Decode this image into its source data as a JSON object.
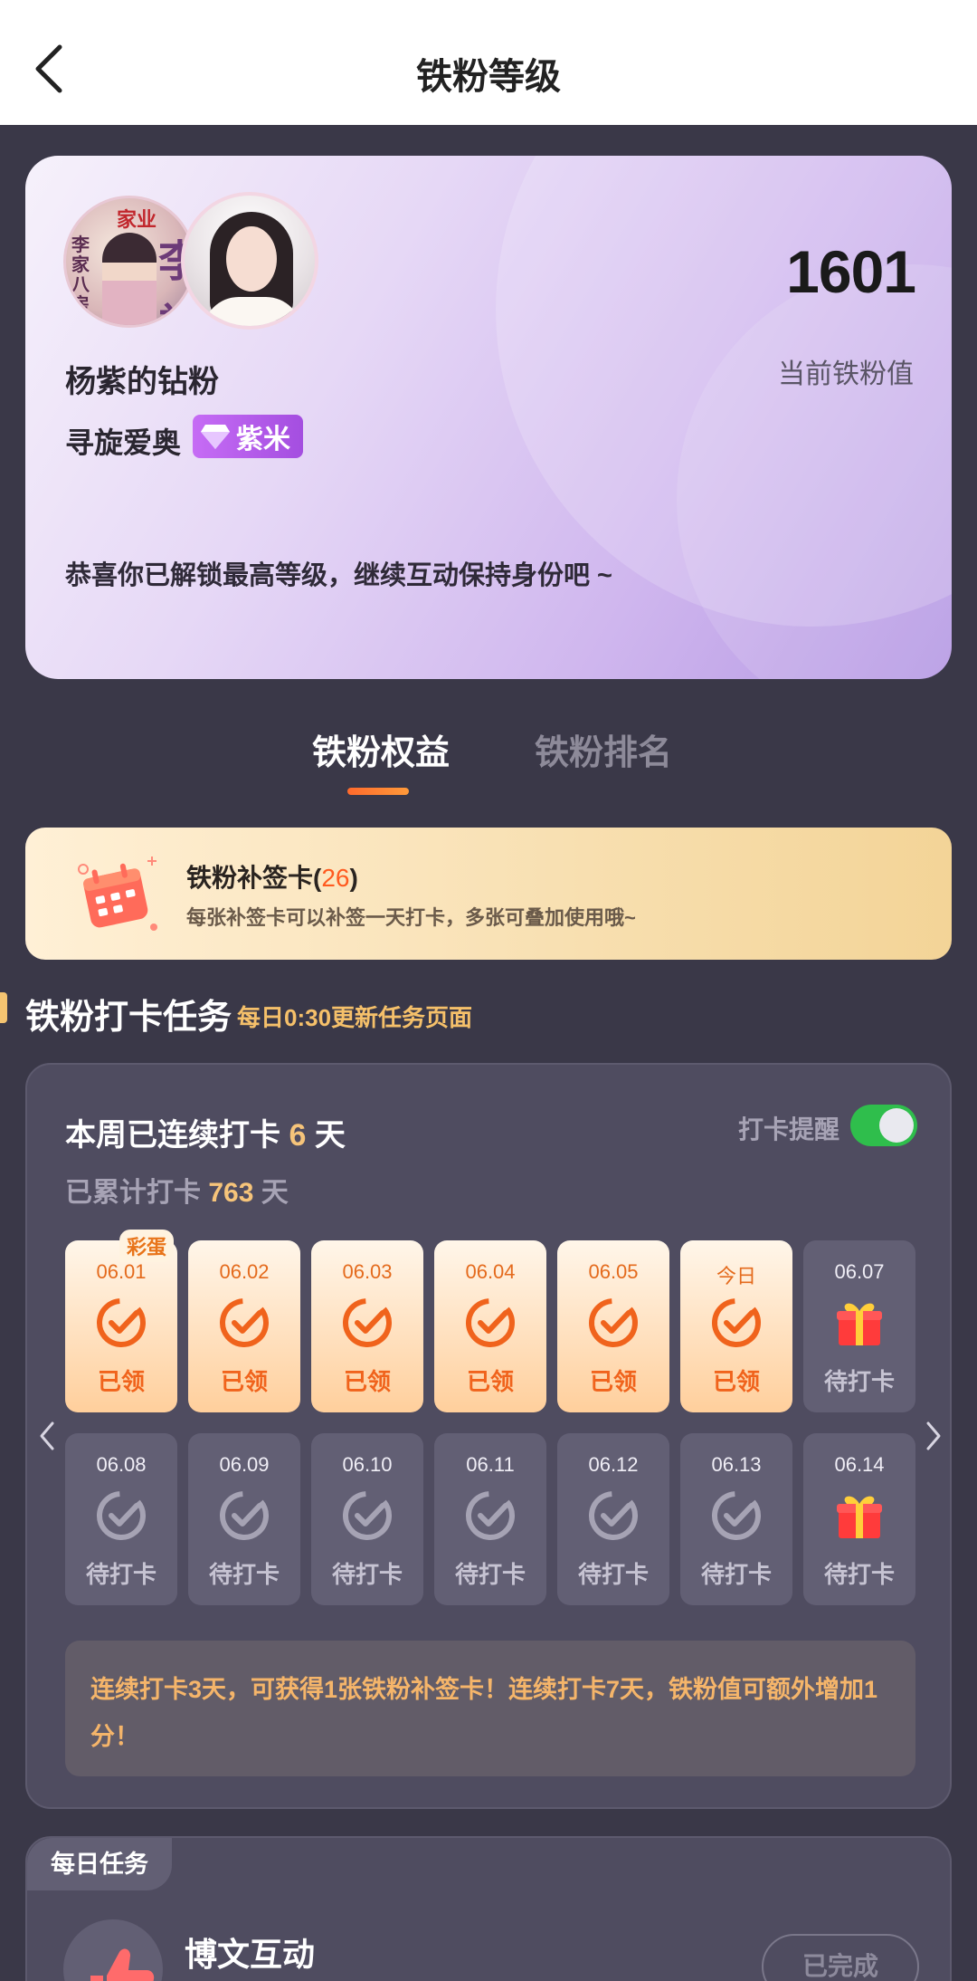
{
  "header": {
    "title": "铁粉等级"
  },
  "profile": {
    "avatar_text_top": "家业",
    "avatar_text_side": "李家八房",
    "avatar_text_big": "李衫",
    "score": "1601",
    "score_label": "当前铁粉值",
    "fan_title": "杨紫的钻粉",
    "fan_name": "寻旋爱奥",
    "badge_label": "紫米",
    "congrats": "恭喜你已解锁最高等级，继续互动保持身份吧 ~"
  },
  "tabs": [
    {
      "label": "铁粉权益",
      "active": true
    },
    {
      "label": "铁粉排名",
      "active": false
    }
  ],
  "makeup_card": {
    "title": "铁粉补签卡",
    "open": "(",
    "count": "26",
    "close": ")",
    "desc": "每张补签卡可以补签一天打卡，多张可叠加使用哦~"
  },
  "section": {
    "title": "铁粉打卡任务",
    "subtitle": "每日0:30更新任务页面"
  },
  "checkin": {
    "streak_prefix": "本周已连续打卡",
    "streak_days": "6",
    "streak_suffix": "天",
    "total_prefix": "已累计打卡",
    "total_days": "763",
    "total_suffix": "天",
    "reminder_label": "打卡提醒",
    "reminder_on": true,
    "egg_label": "彩蛋",
    "days": [
      {
        "date": "06.01",
        "status": "已领",
        "type": "done"
      },
      {
        "date": "06.02",
        "status": "已领",
        "type": "done"
      },
      {
        "date": "06.03",
        "status": "已领",
        "type": "done"
      },
      {
        "date": "06.04",
        "status": "已领",
        "type": "done"
      },
      {
        "date": "06.05",
        "status": "已领",
        "type": "done"
      },
      {
        "date": "今日",
        "status": "已领",
        "type": "done"
      },
      {
        "date": "06.07",
        "status": "待打卡",
        "type": "gift"
      },
      {
        "date": "06.08",
        "status": "待打卡",
        "type": "pending"
      },
      {
        "date": "06.09",
        "status": "待打卡",
        "type": "pending"
      },
      {
        "date": "06.10",
        "status": "待打卡",
        "type": "pending"
      },
      {
        "date": "06.11",
        "status": "待打卡",
        "type": "pending"
      },
      {
        "date": "06.12",
        "status": "待打卡",
        "type": "pending"
      },
      {
        "date": "06.13",
        "status": "待打卡",
        "type": "pending"
      },
      {
        "date": "06.14",
        "status": "待打卡",
        "type": "gift"
      }
    ],
    "tip": "连续打卡3天，可获得1张铁粉补签卡！连续打卡7天，铁粉值可额外增加1分！"
  },
  "daily_task": {
    "tag": "每日任务",
    "title": "博文互动",
    "button": "已完成"
  },
  "colors": {
    "accent_orange": "#f0631c",
    "gold": "#f6c47a",
    "toggle_on": "#2fbe4c",
    "badge_purple": "#b25ce8"
  }
}
